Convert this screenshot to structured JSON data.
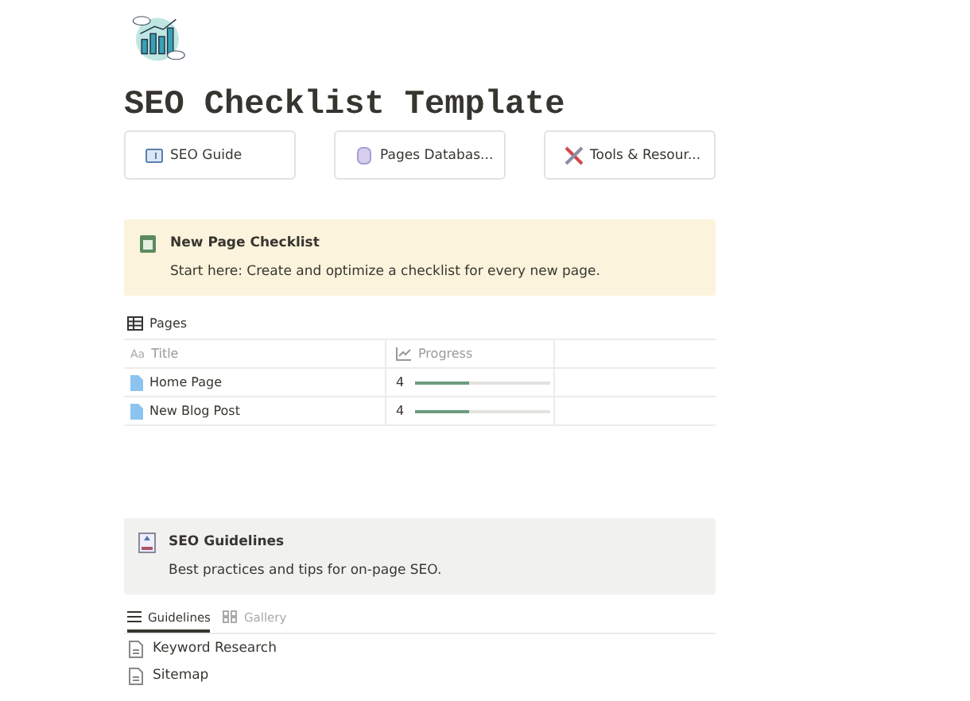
{
  "title": "SEO Checklist Template",
  "links": [
    {
      "label": "SEO Guide",
      "kind": "book"
    },
    {
      "label": "Pages Databas...",
      "kind": "database"
    },
    {
      "label": "Tools & Resour...",
      "kind": "tools"
    }
  ],
  "callout": {
    "title": "New Page Checklist",
    "text": "Start here: Create and optimize a checklist for every new page."
  },
  "database": {
    "title": "Pages",
    "columns": [
      "Title",
      "Progress"
    ],
    "title_type_icon": "Aa",
    "rows": [
      {
        "title": "Home Page",
        "progress": "4",
        "level": 0.4
      },
      {
        "title": "New Blog Post",
        "progress": "4",
        "level": 0.4
      }
    ]
  },
  "guidelines": {
    "title": "SEO Guidelines",
    "text": "Best practices and tips for on-page SEO.",
    "tabs": [
      {
        "label": "Guidelines",
        "selected": true
      },
      {
        "label": "Gallery",
        "selected": false
      }
    ],
    "items": [
      "Keyword Research",
      "Sitemap"
    ]
  }
}
